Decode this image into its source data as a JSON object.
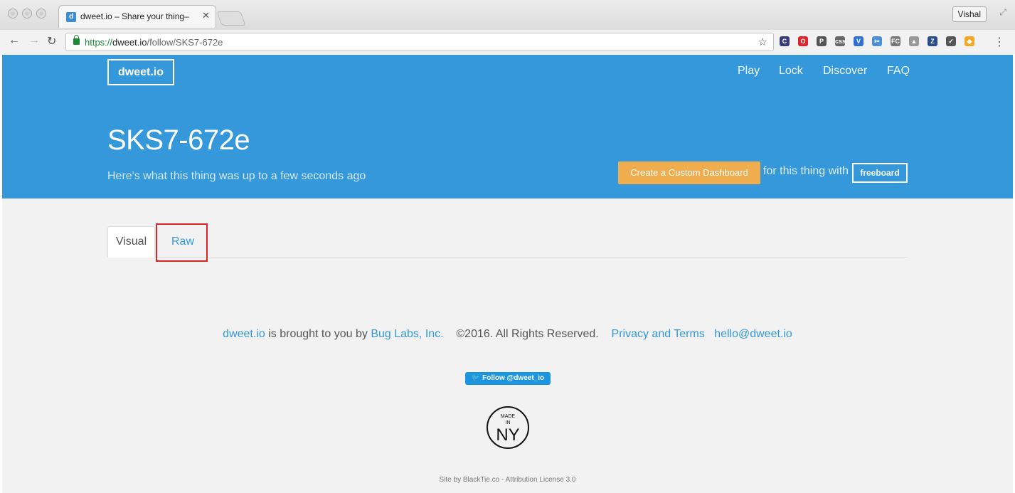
{
  "browser": {
    "tab_title": "dweet.io – Share your thing–",
    "tab_favicon": "d",
    "profile": "Vishal",
    "url_scheme": "https://",
    "url_host": "dweet.io",
    "url_path": "/follow/SKS7-672e",
    "extensions": [
      {
        "icon": "c-circle-icon",
        "color": "#3b3b7a",
        "glyph": "C"
      },
      {
        "icon": "opera-icon",
        "color": "#e0232c",
        "glyph": "O"
      },
      {
        "icon": "pocket-icon",
        "color": "#555",
        "glyph": "P"
      },
      {
        "icon": "css-icon",
        "color": "#666",
        "glyph": "css"
      },
      {
        "icon": "v-icon",
        "color": "#2f6fd6",
        "glyph": "V"
      },
      {
        "icon": "scissors-icon",
        "color": "#4a90d9",
        "glyph": "✂"
      },
      {
        "icon": "fc-icon",
        "color": "#777",
        "glyph": "FC"
      },
      {
        "icon": "drive-icon",
        "color": "#999",
        "glyph": "▲"
      },
      {
        "icon": "z-icon",
        "color": "#2b4c8c",
        "glyph": "Z"
      },
      {
        "icon": "check-mail-icon",
        "color": "#555",
        "glyph": "✓"
      },
      {
        "icon": "colorful-icon",
        "color": "#f5a623",
        "glyph": "◆"
      }
    ]
  },
  "header": {
    "logo": "dweet.io",
    "nav": [
      "Play",
      "Lock",
      "Discover",
      "FAQ"
    ]
  },
  "hero": {
    "title": "SKS7-672e",
    "subtitle": "Here's what this thing was up to a few seconds ago",
    "dashboard_button": "Create a Custom Dashboard",
    "for_thing": "for this thing with",
    "freeboard": "freeboard"
  },
  "tabs": {
    "visual": "Visual",
    "raw": "Raw"
  },
  "footer": {
    "brand": "dweet.io",
    "brought": "is brought to you by",
    "company": "Bug Labs, Inc.",
    "copyright": "©2016. All Rights Reserved.",
    "privacy": "Privacy and Terms",
    "email": "hello@dweet.io",
    "twitter": "Follow @dweet_io",
    "badge_made": "MADE",
    "badge_in": "IN",
    "badge_ny": "NY",
    "credit": "Site by BlackTie.co - Attribution License 3.0"
  },
  "colors": {
    "brand_blue": "#3498db",
    "button_orange": "#f0ad4e",
    "highlight_red": "#d9262b"
  }
}
